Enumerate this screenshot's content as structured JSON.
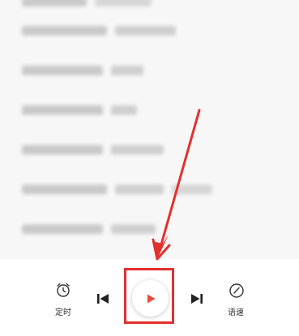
{
  "player": {
    "timer_label": "定时",
    "speed_label": "语速"
  },
  "icons": {
    "timer": "alarm-clock-icon",
    "previous": "skip-previous-icon",
    "play": "play-icon",
    "next": "skip-next-icon",
    "speed": "speedometer-icon"
  },
  "colors": {
    "accent": "#e2302f",
    "play_triangle": "#ea4a3b",
    "text": "#333333"
  }
}
